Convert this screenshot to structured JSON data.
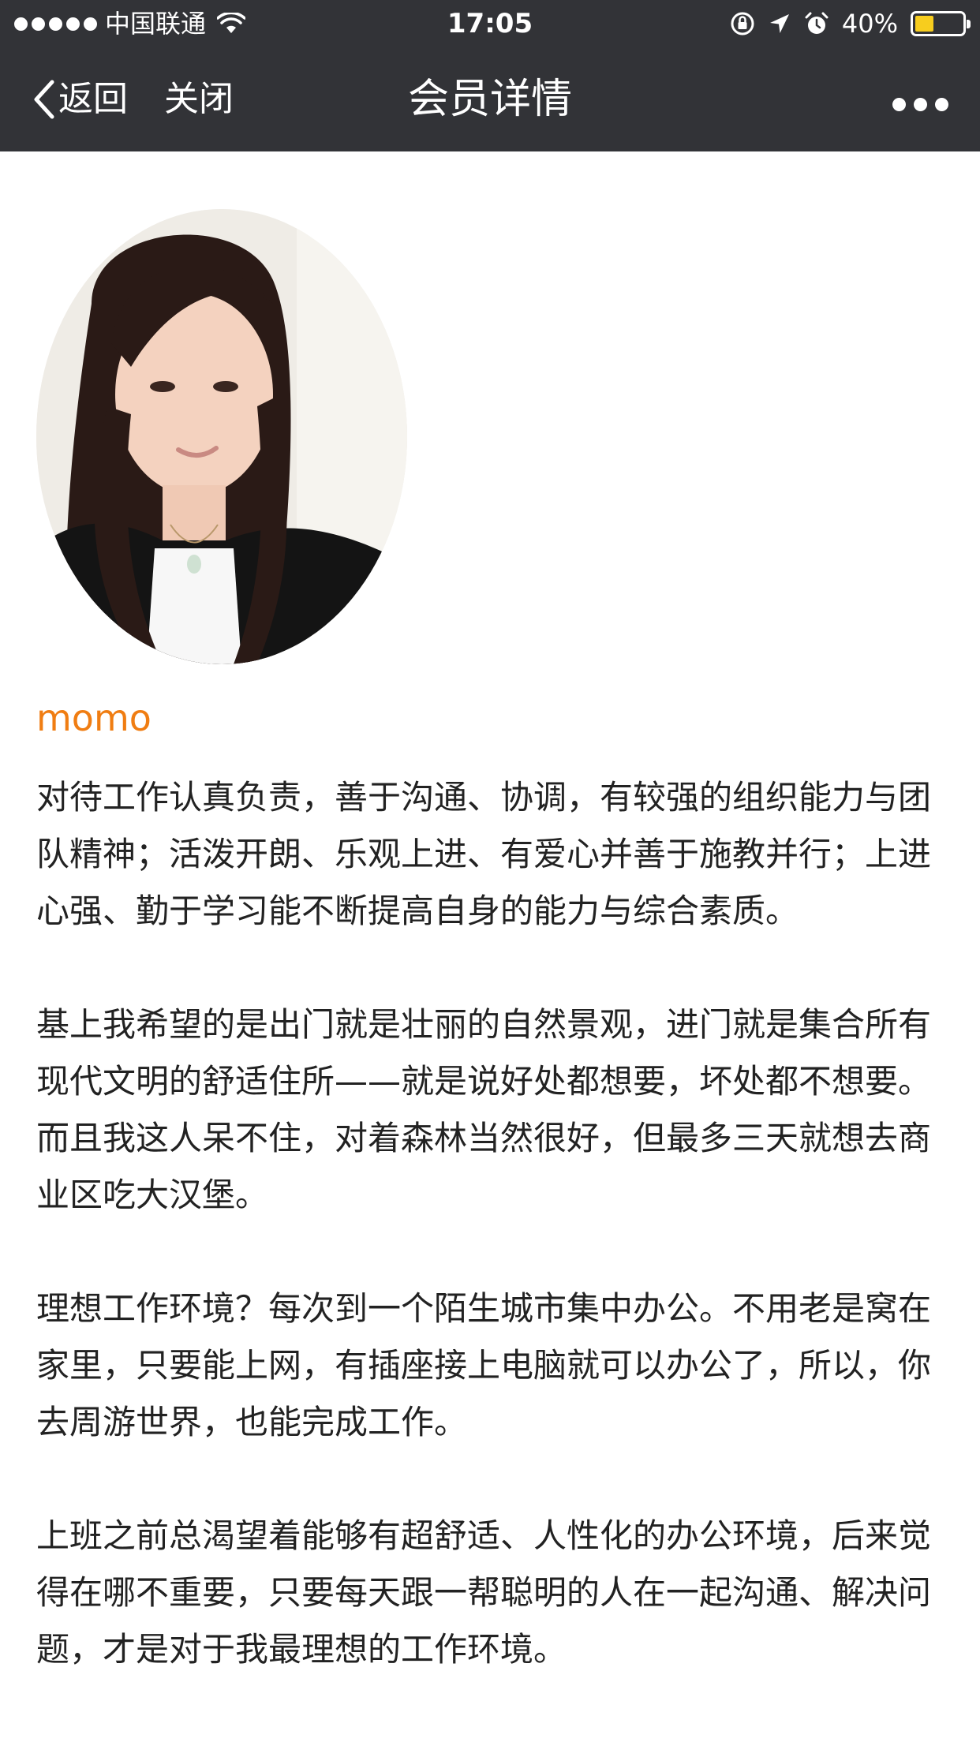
{
  "status_bar": {
    "carrier": "中国联通",
    "time": "17:05",
    "battery_percent_text": "40%",
    "battery_level": 0.4,
    "battery_color": "#f7cd1e",
    "icons": [
      "signal-dots",
      "wifi-icon",
      "lock-rotation-icon",
      "location-arrow-icon",
      "alarm-icon",
      "battery-icon"
    ]
  },
  "nav": {
    "back_label": "返回",
    "close_label": "关闭",
    "title": "会员详情",
    "more_icon": "more-dots-icon",
    "background": "#323337"
  },
  "profile": {
    "name": "momo",
    "name_color": "#f07d12",
    "bio": [
      "对待工作认真负责，善于沟通、协调，有较强的组织能力与团队精神；活泼开朗、乐观上进、有爱心并善于施教并行；上进心强、勤于学习能不断提高自身的能力与综合素质。",
      "基上我希望的是出门就是壮丽的自然景观，进门就是集合所有现代文明的舒适住所——就是说好处都想要，坏处都不想要。而且我这人呆不住，对着森林当然很好，但最多三天就想去商业区吃大汉堡。",
      "理想工作环境？每次到一个陌生城市集中办公。不用老是窝在家里，只要能上网，有插座接上电脑就可以办公了，所以，你去周游世界，也能完成工作。",
      "上班之前总渴望着能够有超舒适、人性化的办公环境，后来觉得在哪不重要，只要每天跟一帮聪明的人在一起沟通、解决问题，才是对于我最理想的工作环境。"
    ]
  }
}
